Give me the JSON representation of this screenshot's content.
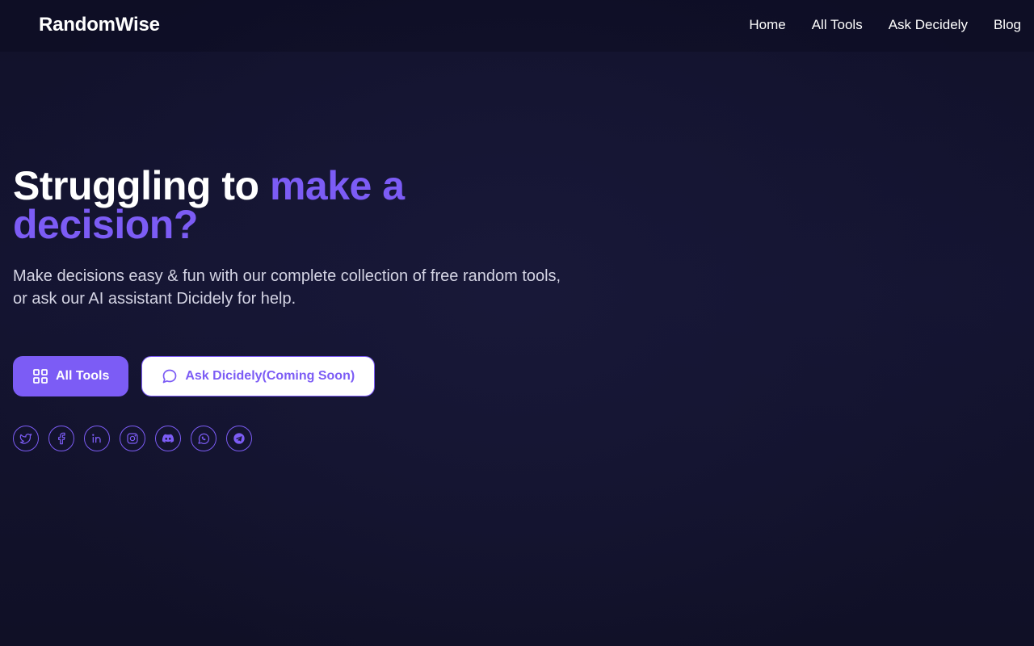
{
  "brand": {
    "name": "RandomWise"
  },
  "nav": {
    "items": [
      {
        "label": "Home"
      },
      {
        "label": "All Tools"
      },
      {
        "label": "Ask Decidely"
      },
      {
        "label": "Blog"
      }
    ]
  },
  "hero": {
    "headline_start": "Struggling to ",
    "headline_accent": "make a decision?",
    "subtitle": "Make decisions easy & fun with our complete collection of free random tools, or ask our AI assistant Dicidely for help."
  },
  "buttons": {
    "primary": {
      "label": "All Tools",
      "icon": "grid-icon"
    },
    "secondary": {
      "label": "Ask Dicidely(Coming Soon)",
      "icon": "chat-bubble-icon"
    }
  },
  "socials": [
    {
      "icon": "twitter-icon"
    },
    {
      "icon": "facebook-icon"
    },
    {
      "icon": "linkedin-icon"
    },
    {
      "icon": "instagram-icon"
    },
    {
      "icon": "discord-icon"
    },
    {
      "icon": "whatsapp-icon"
    },
    {
      "icon": "telegram-icon"
    }
  ],
  "colors": {
    "accent": "#7c5cf5",
    "background": "#11112a",
    "text": "#ffffff",
    "subtext": "#d4d4e4"
  }
}
